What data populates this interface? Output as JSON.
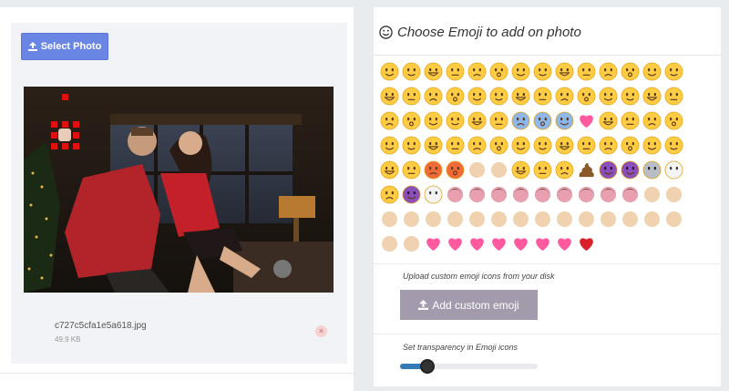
{
  "left": {
    "select_button_label": "Select Photo",
    "file_name": "c727c5cfa1e5a618.jpg",
    "file_size": "49.9 KB",
    "remove_symbol": "×"
  },
  "right": {
    "title": "Choose Emoji to add on photo",
    "upload_label": "Upload custom emoji icons from your disk",
    "add_button_label": "Add custom emoji",
    "transparency_label": "Set transparency in Emoji icons",
    "transparency_level": 0.2
  },
  "colors": {
    "select_button": "#6a86e4",
    "add_button": "#a39aad",
    "slider_fill": "#337ab7",
    "selection_marker": "#e01010"
  },
  "icons": {
    "select": "upload-icon",
    "add": "upload-icon",
    "title": "smiley-outline-icon",
    "remove": "close-icon"
  },
  "emojis": [
    "slightly-smiling",
    "upside-down",
    "grinning",
    "smiley",
    "smile",
    "grin",
    "sweat-smile",
    "joy",
    "relieved",
    "unamused",
    "expressionless",
    "yum",
    "money-mouth",
    "tongue",
    "squint-tongue",
    "wink-tongue",
    "blush",
    "kissing-closed-eyes",
    "relaxed",
    "kissing",
    "pensive",
    "nerd",
    "sunglasses",
    "grimacing",
    "smirk",
    "hugging",
    "wink",
    "neutral",
    "hushed",
    "frowning",
    "anguished",
    "open-mouth",
    "thinking",
    "sleepy",
    "cold-sweat",
    "fearful",
    "scream",
    "heart-eyes",
    "star-struck",
    "flushed",
    "innocent",
    "halo-smile",
    "sleeping",
    "expressionless-2",
    "no-mouth",
    "confused",
    "worried",
    "triumph",
    "weary",
    "persevere",
    "confounded",
    "tired",
    "dizzy",
    "astonished",
    "hushed-2",
    "mask",
    "thermometer",
    "head-bandage",
    "rage",
    "angry",
    "disappointed",
    "disappointed-relieved",
    "sob",
    "cry",
    "crying-face",
    "poop",
    "imp",
    "smiling-imp",
    "alien",
    "ghost",
    "tongue-out",
    "space-invader",
    "eyes",
    "dancers",
    "dancer-pair",
    "woman-1",
    "woman-2",
    "woman-3",
    "woman-4",
    "woman-5",
    "woman-6",
    "woman-7",
    "nail-polish",
    "wave",
    "victory",
    "point-up",
    "point-up-2",
    "thumbs-up",
    "thumbs-down",
    "fist",
    "hand-1",
    "hand-2",
    "open-hands",
    "punch",
    "clap",
    "muscle",
    "pray",
    "rock-on",
    "vulcan",
    "raised-finger",
    "heart-small",
    "revolving-hearts",
    "heart-exclaim",
    "two-hearts",
    "sparkling-heart",
    "gift-heart",
    "growing-heart",
    "broken-heart"
  ]
}
